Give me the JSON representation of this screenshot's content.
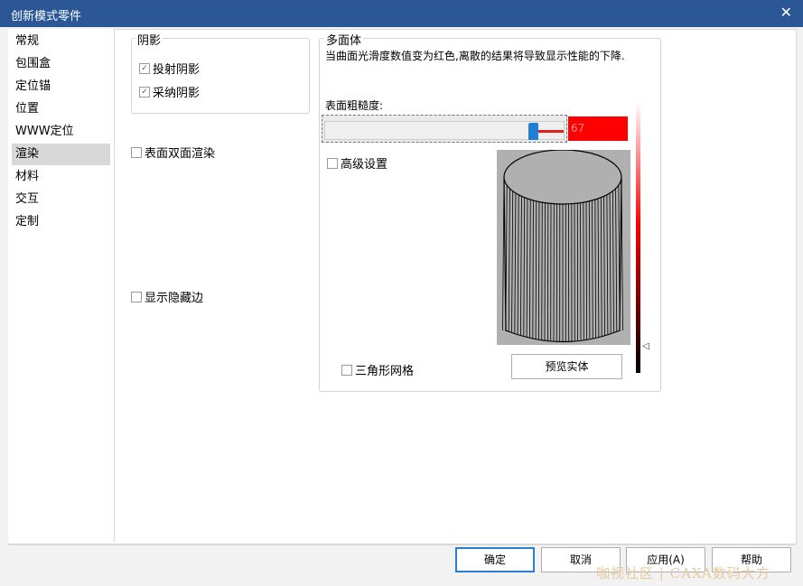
{
  "window": {
    "title": "创新模式零件",
    "close_glyph": "✕"
  },
  "sidebar": {
    "items": [
      {
        "label": "常规"
      },
      {
        "label": "包围盒"
      },
      {
        "label": "定位锚"
      },
      {
        "label": "位置"
      },
      {
        "label": "WWW定位"
      },
      {
        "label": "渲染",
        "selected": true
      },
      {
        "label": "材料"
      },
      {
        "label": "交互"
      },
      {
        "label": "定制"
      }
    ]
  },
  "shadow": {
    "legend": "阴影",
    "cast": {
      "label": "投射阴影",
      "checked": true
    },
    "receive": {
      "label": "采纳阴影",
      "checked": true
    }
  },
  "two_sided": {
    "label": "表面双面渲染",
    "checked": false
  },
  "hidden_edges": {
    "label": "显示隐藏边",
    "checked": false
  },
  "polyhedron": {
    "legend": "多面体",
    "note": "当曲面光滑度数值变为红色,离散的结果将导致显示性能的下降.",
    "roughness_label": "表面粗糙度:",
    "roughness_value": "67",
    "roughness_fraction": 0.87,
    "advanced": {
      "label": "高级设置",
      "checked": false
    },
    "triangle_mesh": {
      "label": "三角形网格",
      "checked": false
    },
    "preview_button": "预览实体",
    "gradient_marker_glyph": "◁"
  },
  "colors": {
    "titlebar": "#2b5797",
    "value_box": "#ff0000",
    "slider_thumb": "#1f7fd6"
  },
  "footer": {
    "ok": "确定",
    "cancel": "取消",
    "apply": "应用(A)",
    "help": "帮助"
  },
  "watermark": "咖视社区 | CAXA数码大方"
}
